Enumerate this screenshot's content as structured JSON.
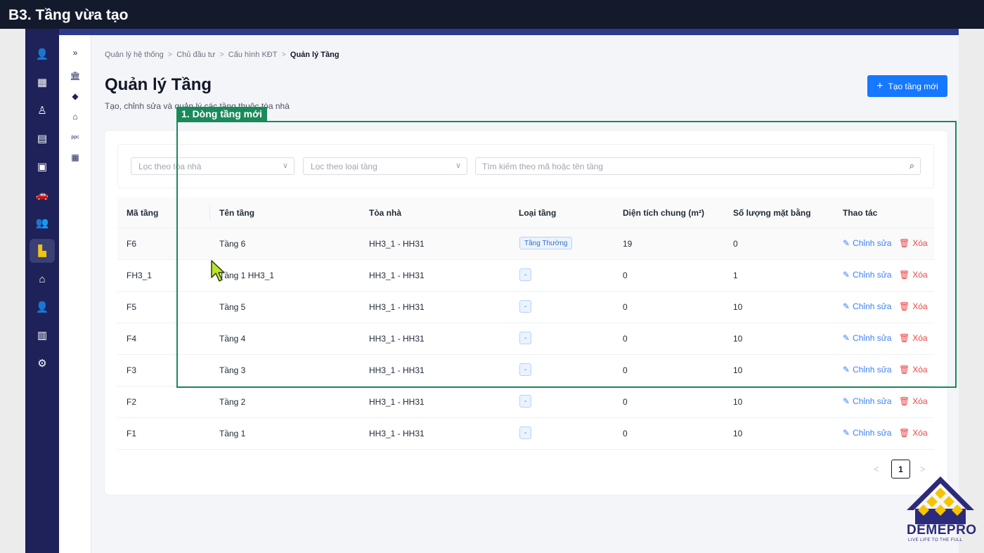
{
  "banner": {
    "title": "B3. Tầng vừa tạo"
  },
  "colors": {
    "rail_bg": "#1e2258",
    "primary": "#1677ff",
    "highlight": "#1a8a5a",
    "danger": "#ef4444",
    "active_icon": "#f1c40f"
  },
  "rail": {
    "items": [
      {
        "icon": "user-icon",
        "glyph": "👤"
      },
      {
        "icon": "building-icon",
        "glyph": "▦"
      },
      {
        "icon": "person-tree-icon",
        "glyph": "♙"
      },
      {
        "icon": "calculator-icon",
        "glyph": "▤"
      },
      {
        "icon": "briefcase-icon",
        "glyph": "▣"
      },
      {
        "icon": "car-icon",
        "glyph": "🚗"
      },
      {
        "icon": "users-icon",
        "glyph": "👥"
      },
      {
        "icon": "floor-plan-icon",
        "glyph": "▙",
        "active": true
      },
      {
        "icon": "store-icon",
        "glyph": "⌂"
      },
      {
        "icon": "user-tie-icon",
        "glyph": "👤"
      },
      {
        "icon": "chart-icon",
        "glyph": "▥"
      },
      {
        "icon": "gear-icon",
        "glyph": "⚙"
      }
    ]
  },
  "subnav": {
    "expand_glyph": "»",
    "items": [
      {
        "icon": "bank-icon",
        "glyph": "🏛"
      },
      {
        "icon": "tag-icon",
        "glyph": "◆"
      },
      {
        "icon": "shop-icon",
        "glyph": "⌂"
      },
      {
        "icon": "ppc-icon",
        "glyph": "ppc"
      },
      {
        "icon": "building-small-icon",
        "glyph": "▦"
      }
    ]
  },
  "breadcrumb": {
    "items": [
      "Quản lý hệ thống",
      "Chủ đầu tư",
      "Cấu hình KĐT"
    ],
    "current": "Quản lý Tầng",
    "sep": ">"
  },
  "header": {
    "title": "Quản lý Tầng",
    "subtitle": "Tạo, chỉnh sửa và quản lý các tầng thuộc tòa nhà",
    "create_label": "Tạo tầng mới",
    "create_glyph": "+"
  },
  "filters": {
    "building_placeholder": "Lọc theo tòa nhà",
    "type_placeholder": "Lọc theo loại tầng",
    "search_placeholder": "Tìm kiếm theo mã hoặc tên tầng",
    "chevron": "∨",
    "search_glyph": "⌕"
  },
  "table": {
    "columns": [
      "Mã tầng",
      "Tên tầng",
      "Tòa nhà",
      "Loại tầng",
      "Diện tích chung (m²)",
      "Số lượng mặt bằng",
      "Thao tác"
    ],
    "edit_label": "Chỉnh sửa",
    "delete_label": "Xóa",
    "edit_glyph": "✎",
    "delete_glyph": "🗑",
    "rows": [
      {
        "code": "F6",
        "name": "Tầng 6",
        "building": "HH3_1 - HH31",
        "type": "Tầng Thường",
        "area": "19",
        "count": "0"
      },
      {
        "code": "FH3_1",
        "name": "Tầng 1 HH3_1",
        "building": "HH3_1 - HH31",
        "type": "-",
        "area": "0",
        "count": "1"
      },
      {
        "code": "F5",
        "name": "Tầng 5",
        "building": "HH3_1 - HH31",
        "type": "-",
        "area": "0",
        "count": "10"
      },
      {
        "code": "F4",
        "name": "Tầng 4",
        "building": "HH3_1 - HH31",
        "type": "-",
        "area": "0",
        "count": "10"
      },
      {
        "code": "F3",
        "name": "Tầng 3",
        "building": "HH3_1 - HH31",
        "type": "-",
        "area": "0",
        "count": "10"
      },
      {
        "code": "F2",
        "name": "Tầng 2",
        "building": "HH3_1 - HH31",
        "type": "-",
        "area": "0",
        "count": "10"
      },
      {
        "code": "F1",
        "name": "Tầng 1",
        "building": "HH3_1 - HH31",
        "type": "-",
        "area": "0",
        "count": "10"
      }
    ]
  },
  "pagination": {
    "current": "1",
    "prev": "<",
    "next": ">"
  },
  "annotation": {
    "label": "1. Dòng tầng mới"
  },
  "logo": {
    "name": "DEMEPRO",
    "tagline": "LIVE LIFE TO THE FULL"
  }
}
